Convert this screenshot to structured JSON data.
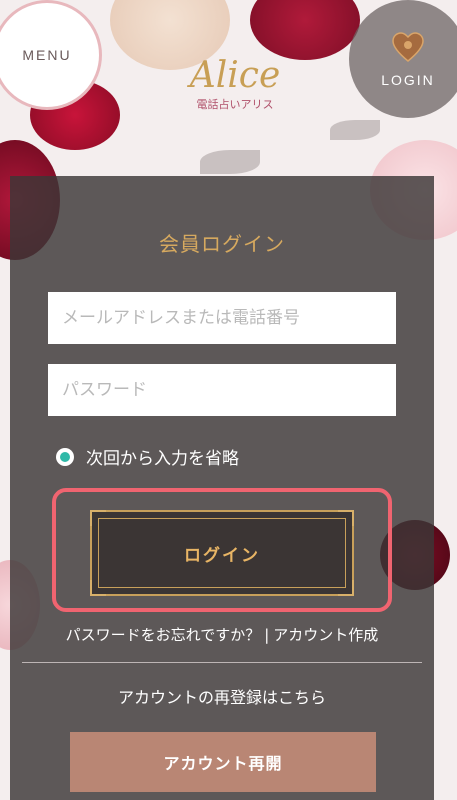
{
  "header": {
    "menu_label": "MENU",
    "login_label": "LOGIN",
    "logo_text": "Alice",
    "logo_subtitle": "電話占いアリス"
  },
  "login_form": {
    "title": "会員ログイン",
    "email_placeholder": "メールアドレスまたは電話番号",
    "password_placeholder": "パスワード",
    "remember_label": "次回から入力を省略",
    "remember_checked": true,
    "login_button": "ログイン",
    "forgot_password_link": "パスワードをお忘れですか？",
    "separator": "|",
    "create_account_link": "アカウント作成",
    "reregister_text": "アカウントの再登録はこちら",
    "reactivate_button": "アカウント再開"
  },
  "colors": {
    "accent_gold": "#c8a05a",
    "panel_bg": "#3c3737",
    "highlight_red": "#f06470",
    "radio_teal": "#2fb9a8",
    "reactivate_bg": "#b98674"
  }
}
